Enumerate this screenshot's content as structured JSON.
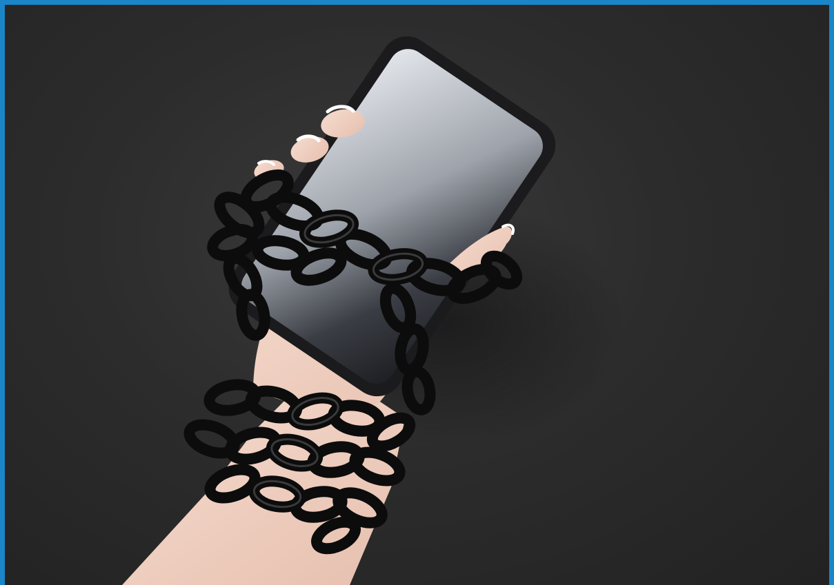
{
  "photo": {
    "frame_color": "#1a86c8",
    "background_color": "#2e2e2e",
    "skin_color": "#f1d3c4",
    "chain_color": "#0c0c0c",
    "phone_body_color": "#1b1b1d",
    "phone_screen_color": "#c9ccd3"
  }
}
